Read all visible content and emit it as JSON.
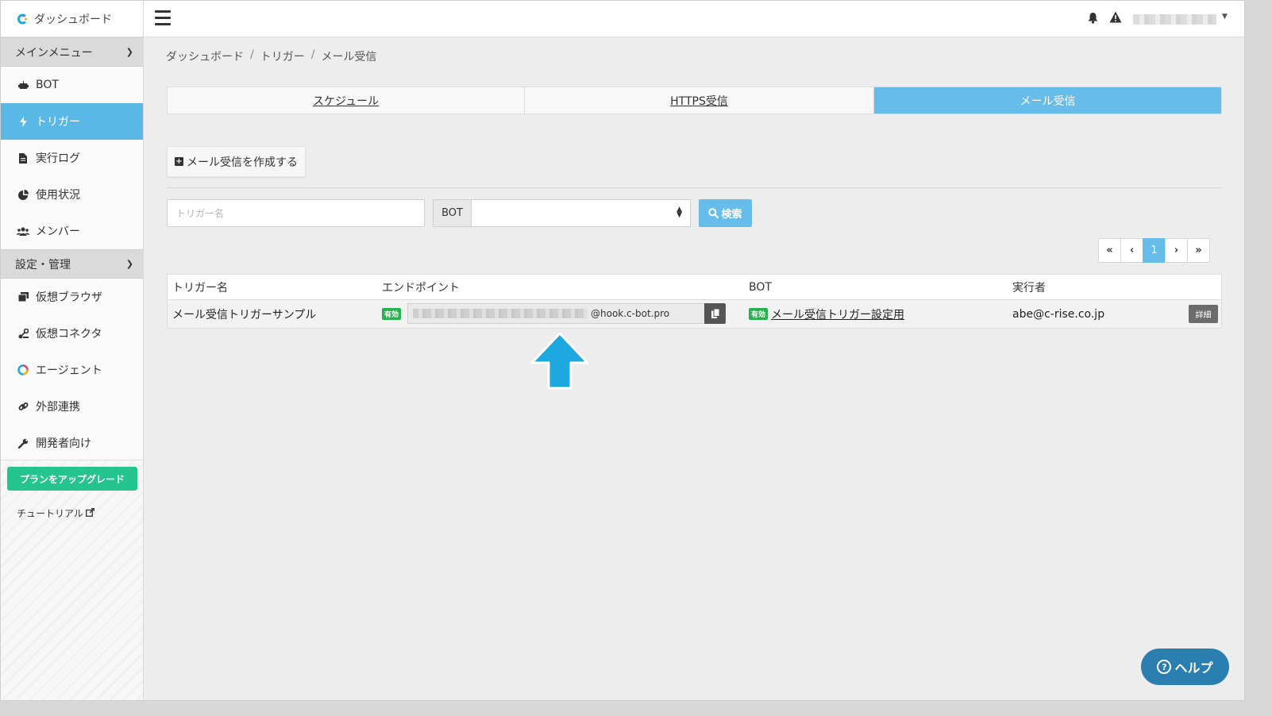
{
  "brand": {
    "title": "ダッシュボード"
  },
  "sidebar": {
    "main_menu_label": "メインメニュー",
    "main_items": [
      {
        "label": "BOT",
        "icon": "robot-icon"
      },
      {
        "label": "トリガー",
        "icon": "bolt-icon",
        "active": true
      },
      {
        "label": "実行ログ",
        "icon": "file-icon"
      },
      {
        "label": "使用状況",
        "icon": "pie-chart-icon"
      },
      {
        "label": "メンバー",
        "icon": "users-icon"
      }
    ],
    "settings_label": "設定・管理",
    "settings_items": [
      {
        "label": "仮想ブラウザ",
        "icon": "window-icon"
      },
      {
        "label": "仮想コネクタ",
        "icon": "connector-icon"
      },
      {
        "label": "エージェント",
        "icon": "agent-icon"
      },
      {
        "label": "外部連携",
        "icon": "link-icon"
      },
      {
        "label": "開発者向け",
        "icon": "wrench-icon"
      }
    ],
    "upgrade_label": "プランをアップグレード",
    "tutorial_label": "チュートリアル"
  },
  "breadcrumb": [
    "ダッシュボード",
    "トリガー",
    "メール受信"
  ],
  "tabs": [
    "スケジュール",
    "HTTPS受信",
    "メール受信"
  ],
  "create_button": "メール受信を作成する",
  "search": {
    "trigger_placeholder": "トリガー名",
    "bot_label": "BOT",
    "bot_value": "",
    "button": "検索"
  },
  "pagination": {
    "current": "1"
  },
  "table": {
    "headers": [
      "トリガー名",
      "エンドポイント",
      "BOT",
      "実行者"
    ],
    "rows": [
      {
        "name": "メール受信トリガーサンプル",
        "status": "有効",
        "endpoint_domain": "@hook.c-bot.pro",
        "bot_status": "有効",
        "bot_name": "メール受信トリガー設定用",
        "executor": "abe@c-rise.co.jp",
        "detail": "詳細"
      }
    ]
  },
  "help_label": "ヘルプ",
  "colors": {
    "accent": "#5ab8e6",
    "upgrade": "#23c48e",
    "badge": "#28b24f",
    "arrow": "#1ea8e0"
  }
}
